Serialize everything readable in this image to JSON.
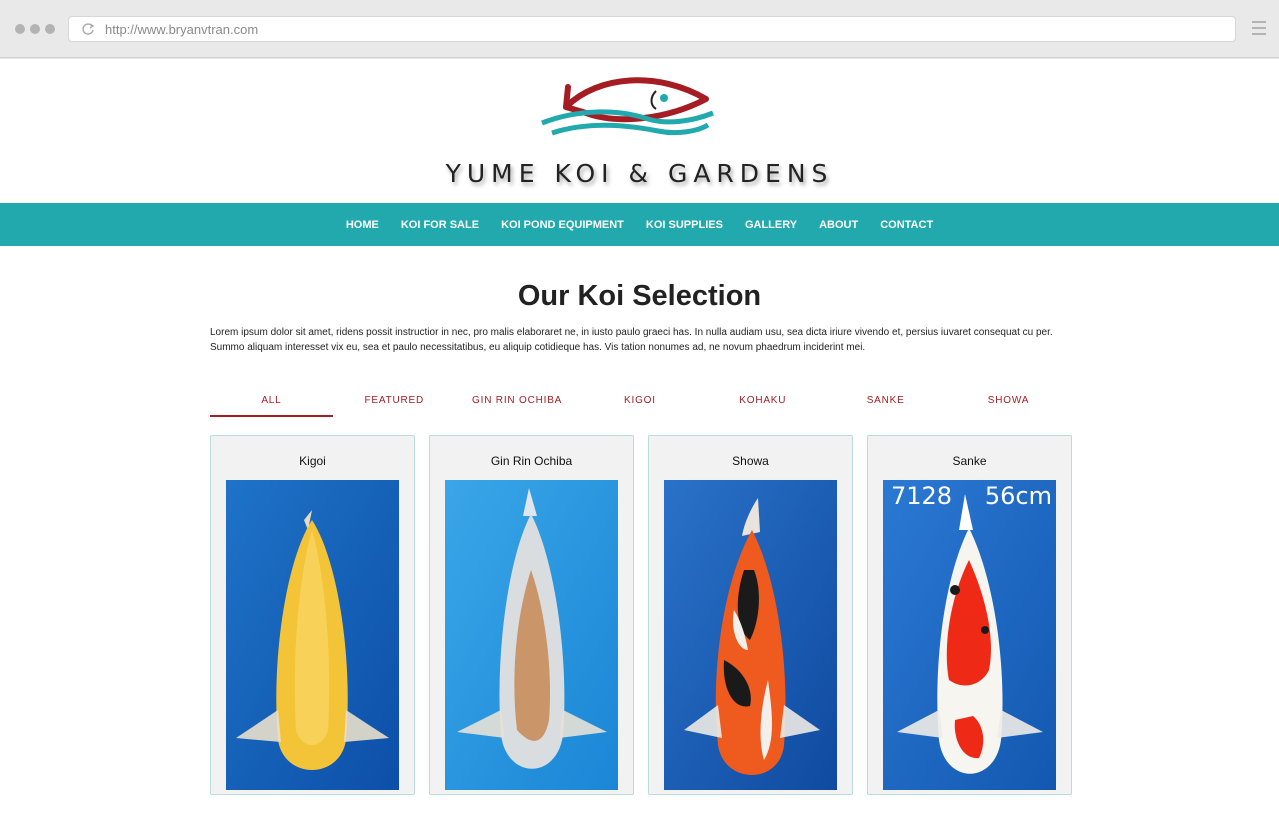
{
  "browser": {
    "url": "http://www.bryanvtran.com"
  },
  "brand": {
    "name": "YUME KOI & GARDENS",
    "colors": {
      "teal": "#21a9ad",
      "red": "#a51c22"
    }
  },
  "nav": {
    "items": [
      {
        "label": "HOME"
      },
      {
        "label": "KOI FOR SALE"
      },
      {
        "label": "KOI POND EQUIPMENT"
      },
      {
        "label": "KOI SUPPLIES"
      },
      {
        "label": "GALLERY"
      },
      {
        "label": "ABOUT"
      },
      {
        "label": "CONTACT"
      }
    ]
  },
  "main": {
    "title": "Our Koi Selection",
    "intro": "Lorem ipsum dolor sit amet, ridens possit instructior in nec, pro malis elaboraret ne, in iusto paulo graeci has. In nulla audiam usu, sea dicta iriure vivendo et, persius iuvaret consequat cu per. Summo aliquam interesset vix eu, sea et paulo necessitatibus, eu aliquip cotidieque has. Vis tation nonumes ad, ne novum phaedrum inciderint mei.",
    "tabs": [
      {
        "label": "ALL",
        "active": true
      },
      {
        "label": "FEATURED"
      },
      {
        "label": "GIN RIN OCHIBA"
      },
      {
        "label": "KIGOI"
      },
      {
        "label": "KOHAKU"
      },
      {
        "label": "SANKE"
      },
      {
        "label": "SHOWA"
      }
    ],
    "cards": [
      {
        "title": "Kigoi"
      },
      {
        "title": "Gin Rin Ochiba"
      },
      {
        "title": "Showa"
      },
      {
        "title": "Sanke",
        "photo_id": "7128",
        "photo_size": "56cm"
      }
    ]
  }
}
